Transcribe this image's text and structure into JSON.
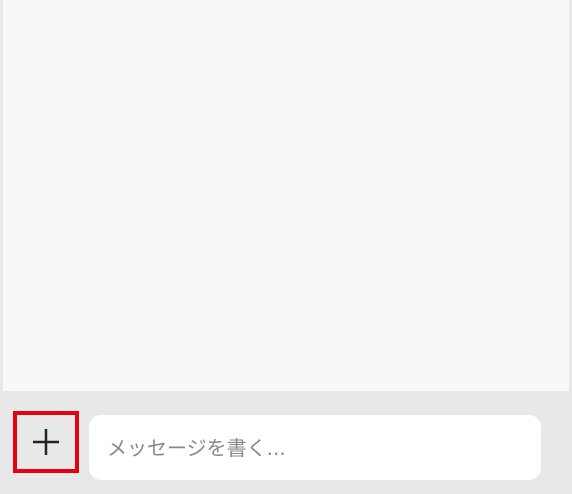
{
  "composer": {
    "input_placeholder": "メッセージを書く...",
    "input_value": "",
    "attach_icon": "plus-icon",
    "highlight_color": "#e60012"
  },
  "colors": {
    "chat_background": "#f8f8f8",
    "bar_background": "#e8e8e8",
    "input_background": "#ffffff"
  }
}
